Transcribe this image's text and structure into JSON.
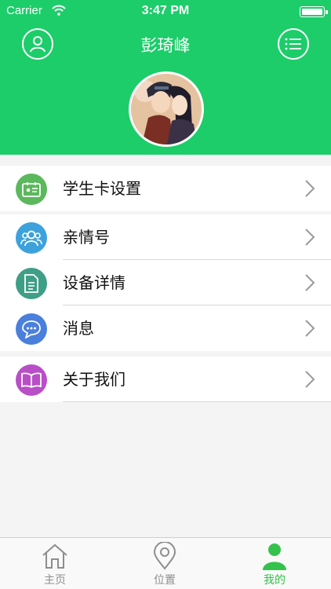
{
  "status_bar": {
    "carrier": "Carrier",
    "time": "3:47 PM"
  },
  "header": {
    "title": "彭琦峰",
    "left_button_icon": "user-icon",
    "right_button_icon": "list-menu-icon",
    "background_color": "#1ccd6a"
  },
  "menu": {
    "group1": [
      {
        "label": "学生卡设置",
        "icon": "id-card-icon",
        "color": "#5cb85c"
      }
    ],
    "group2": [
      {
        "label": "亲情号",
        "icon": "family-icon",
        "color": "#3da1dc"
      },
      {
        "label": "设备详情",
        "icon": "document-icon",
        "color": "#3f9e86"
      },
      {
        "label": "消息",
        "icon": "message-icon",
        "color": "#4a7fdc"
      }
    ],
    "group3": [
      {
        "label": "关于我们",
        "icon": "book-icon",
        "color": "#b84fc6"
      }
    ]
  },
  "tabbar": {
    "tabs": [
      {
        "label": "主页",
        "icon": "home-icon"
      },
      {
        "label": "位置",
        "icon": "location-pin-icon"
      },
      {
        "label": "我的",
        "icon": "person-icon"
      }
    ],
    "active": "我的",
    "active_color": "#35c24c"
  }
}
